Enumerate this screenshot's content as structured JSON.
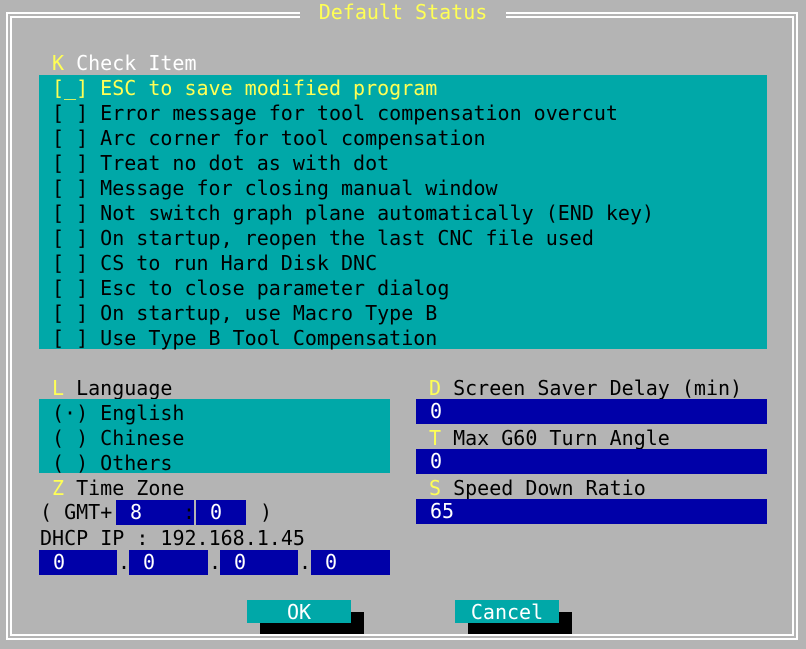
{
  "dialog": {
    "title": "Default Status"
  },
  "check": {
    "hotkey": "K",
    "heading": "Check Item",
    "items": [
      {
        "box": "[_]",
        "label": "ESC to save modified program"
      },
      {
        "box": "[ ]",
        "label": "Error message for tool compensation overcut"
      },
      {
        "box": "[ ]",
        "label": "Arc corner for tool compensation"
      },
      {
        "box": "[ ]",
        "label": "Treat no dot as with dot"
      },
      {
        "box": "[ ]",
        "label": "Message for closing manual window"
      },
      {
        "box": "[ ]",
        "label": "Not switch graph plane automatically (END key)"
      },
      {
        "box": "[ ]",
        "label": "On startup, reopen the last CNC file used"
      },
      {
        "box": "[ ]",
        "label": "CS to run Hard Disk DNC"
      },
      {
        "box": "[ ]",
        "label": "Esc to close parameter dialog"
      },
      {
        "box": "[ ]",
        "label": "On startup, use Macro Type B"
      },
      {
        "box": "[ ]",
        "label": "Use Type B Tool Compensation"
      }
    ]
  },
  "language": {
    "hotkey": "L",
    "heading": "Language",
    "options": [
      {
        "mark": "(·)",
        "label": "English"
      },
      {
        "mark": "( )",
        "label": "Chinese"
      },
      {
        "mark": "( )",
        "label": "Others"
      }
    ]
  },
  "timezone": {
    "hotkey": "Z",
    "heading": "Time Zone",
    "prefix": "( GMT+",
    "hours": "8",
    "sep": ":",
    "minutes": "0",
    "suffix": ")"
  },
  "dhcp": {
    "label": "DHCP IP : 192.168.1.45",
    "octets": [
      "0",
      "0",
      "0",
      "0"
    ],
    "dot": "."
  },
  "screensaver": {
    "hotkey": "D",
    "heading": "Screen Saver Delay (min)",
    "value": "0"
  },
  "g60": {
    "hotkey": "T",
    "heading": "Max G60 Turn Angle",
    "value": "0"
  },
  "speed": {
    "hotkey": "S",
    "heading": "Speed Down Ratio",
    "value": "65"
  },
  "buttons": {
    "ok": "OK",
    "cancel": "Cancel"
  },
  "colors": {
    "background": "#b4b4b4",
    "panel": "#00a8a8",
    "field": "#0000a8",
    "hotkey": "#ffff55",
    "text": "#ffffff"
  }
}
